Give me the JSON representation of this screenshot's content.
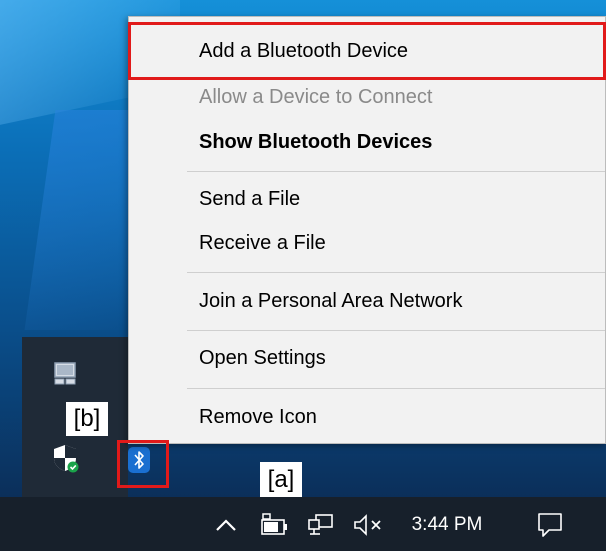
{
  "context_menu": {
    "items": [
      {
        "label": "Add a Bluetooth Device",
        "enabled": true,
        "bold": false
      },
      {
        "label": "Allow a Device to Connect",
        "enabled": false,
        "bold": false
      },
      {
        "label": "Show Bluetooth Devices",
        "enabled": true,
        "bold": true
      },
      {
        "label": "Send a File",
        "enabled": true,
        "bold": false
      },
      {
        "label": "Receive a File",
        "enabled": true,
        "bold": false
      },
      {
        "label": "Join a Personal Area Network",
        "enabled": true,
        "bold": false
      },
      {
        "label": "Open Settings",
        "enabled": true,
        "bold": false
      },
      {
        "label": "Remove Icon",
        "enabled": true,
        "bold": false
      }
    ]
  },
  "annotations": {
    "a": "[a]",
    "b": "[b]"
  },
  "taskbar": {
    "clock": "3:44 PM",
    "icons": [
      "chevron-up-icon",
      "battery-icon",
      "network-icon",
      "volume-muted-icon",
      "notification-icon"
    ]
  },
  "tray_flyout": {
    "icons": [
      "touchpad-icon",
      "windows-security-icon",
      "bluetooth-icon"
    ]
  },
  "colors": {
    "highlight": "#e11a1a",
    "taskbar": "#17202b",
    "menu_bg": "#f2f2f2",
    "bluetooth": "#1a6fd0"
  }
}
